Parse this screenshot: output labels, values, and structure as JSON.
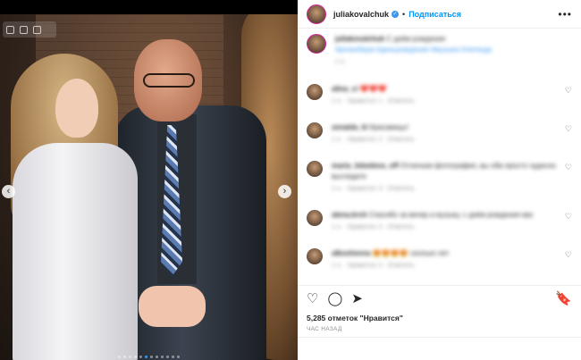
{
  "post": {
    "username": "juliakovalchuk",
    "follow_label": "Подписаться",
    "more_glyph": "•••",
    "verified_glyph": "✓",
    "dot": "•"
  },
  "caption": {
    "username": "juliakovalchuk",
    "text": "С днём рождения",
    "hashtags": "#розенбаум #деньрождения #музыка #легенда",
    "meta": "1 н."
  },
  "comments": [
    {
      "name": "alina_ci",
      "text": "❤️❤️❤️",
      "meta": "1 н. · Нравится: 1 · Ответить"
    },
    {
      "name": "zenaida_ki",
      "text": "Красавицы!",
      "meta": "1 н. · Нравится: 2 · Ответить"
    },
    {
      "name": "maria_lebedeva_off",
      "text": "Отличная фотография, вы оба просто чудесно выглядите",
      "meta": "1 н. · Нравится: 3 · Ответить"
    },
    {
      "name": "alena.krch",
      "text": "Спасибо за вечер и музыку, с днём рождения вас",
      "meta": "1 н. · Нравится: 4 · Ответить"
    },
    {
      "name": "alkoshevna",
      "text": "😍😍😍😍 сколько лет",
      "meta": "1 н. · Нравится: 3 · Ответить"
    }
  ],
  "heart_glyph": "♡",
  "actions": {
    "like": "♡",
    "comment": "◯",
    "share": "➤",
    "save": "🔖"
  },
  "likes_text": "5,285 отметок \"Нравится\"",
  "time_text": "ЧАС НАЗАД",
  "carousel": {
    "prev": "‹",
    "next": "›",
    "slide_count": 12,
    "active_index": 5
  },
  "colors": {
    "accent": "#0095f6",
    "verified": "#3897f0",
    "active_dot": "#3897f0"
  }
}
